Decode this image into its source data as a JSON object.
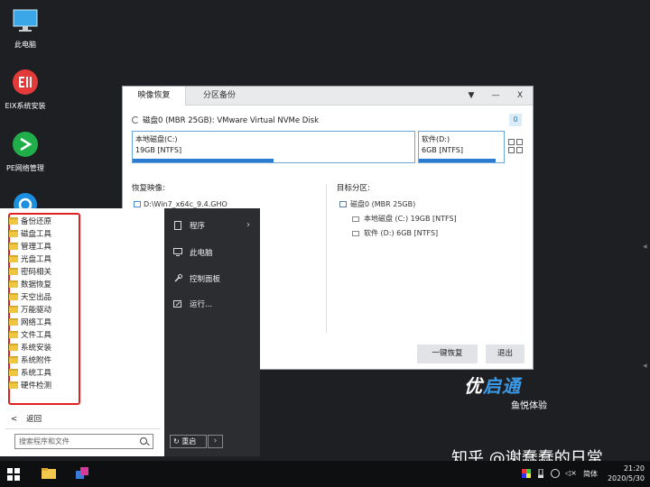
{
  "desktop": {
    "icons": [
      {
        "label": "此电脑",
        "icon": "computer-icon"
      },
      {
        "label": "EIX系统安装",
        "icon": "eix-icon"
      },
      {
        "label": "PE网络管理",
        "icon": "network-icon"
      },
      {
        "label": "",
        "icon": "browser-icon"
      }
    ]
  },
  "window": {
    "tabs": [
      "映像恢复",
      "分区备份"
    ],
    "controls": {
      "menu": "▼",
      "minimize": "—",
      "close": "X"
    },
    "disk_label": "磁盘0 (MBR 25GB): VMware Virtual NVMe Disk",
    "disk_count": "0",
    "partitions": [
      {
        "name": "本地磁盘(C:)",
        "info": "19GB [NTFS]",
        "usage": 0.5
      },
      {
        "name": "软件(D:)",
        "info": "6GB [NTFS]",
        "usage": 0.9
      }
    ],
    "restore_title": "恢复映像:",
    "image_path": "D:\\Win7_x64c_9.4.GHO",
    "target_title": "目标分区:",
    "target_tree": {
      "disk": "磁盘0 (MBR 25GB)",
      "parts": [
        "本地磁盘 (C:) 19GB [NTFS]",
        "软件 (D:) 6GB [NTFS]"
      ]
    },
    "buttons": {
      "restore": "一键恢复",
      "exit": "退出"
    }
  },
  "start_menu": {
    "items": [
      "备份还原",
      "磁盘工具",
      "管理工具",
      "光盘工具",
      "密码相关",
      "数据恢复",
      "天空出品",
      "万能驱动",
      "网络工具",
      "文件工具",
      "系统安装",
      "系统附件",
      "系统工具",
      "硬件检测"
    ],
    "back": "返回",
    "search_placeholder": "搜索程序和文件",
    "right_items": [
      "程序",
      "此电脑",
      "控制面板",
      "运行..."
    ],
    "restart": "重启"
  },
  "brand": {
    "name_white": "优",
    "name_blue": "启通",
    "sub": "鱼悦体验"
  },
  "watermark": "知乎 @谢蠢蠢的日常",
  "taskbar": {
    "ime": "简体",
    "time": "21:20",
    "date": "2020/5/30"
  }
}
